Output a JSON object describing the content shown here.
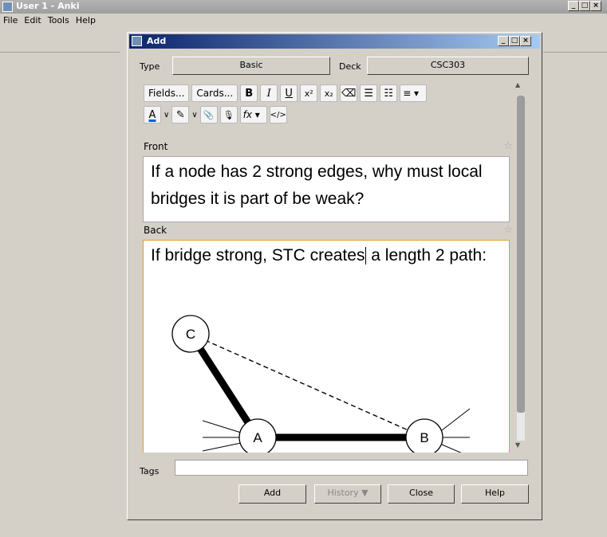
{
  "main_window": {
    "title": "User 1 - Anki",
    "menu": [
      "File",
      "Edit",
      "Tools",
      "Help"
    ],
    "controls": {
      "minimize": "_",
      "maximize": "□",
      "close": "×"
    }
  },
  "dialog": {
    "title": "Add",
    "controls": {
      "minimize": "_",
      "maximize": "□",
      "close": "×"
    },
    "type_label": "Type",
    "type_value": "Basic",
    "deck_label": "Deck",
    "deck_value": "CSC303",
    "toolbar": {
      "fields_label": "Fields...",
      "cards_label": "Cards...",
      "bold": "B",
      "italic": "I",
      "underline": "U",
      "superscript": "x²",
      "subscript": "x₂",
      "eraser": "⌫",
      "bullet_list": "☰",
      "numbered_list": "☷",
      "align": "≡ ▾",
      "text_color": "A",
      "highlight": "✎",
      "dropdown": "∨",
      "attach": "📎",
      "record": "🎙",
      "formula": "fx ▾",
      "html": "</>"
    },
    "fields": [
      {
        "name": "Front",
        "value": "If a node has 2 strong edges, why must local bridges it is part of be weak?"
      },
      {
        "name": "Back",
        "value_before_caret": "If bridge strong, STC creates",
        "value_after_caret": " a length 2 path:"
      }
    ],
    "diagram": {
      "nodes": [
        {
          "id": "C"
        },
        {
          "id": "A"
        },
        {
          "id": "B"
        }
      ]
    },
    "tags_label": "Tags",
    "tags_value": "",
    "buttons": {
      "add": "Add",
      "history": "History ▼",
      "close": "Close",
      "help": "Help"
    }
  }
}
